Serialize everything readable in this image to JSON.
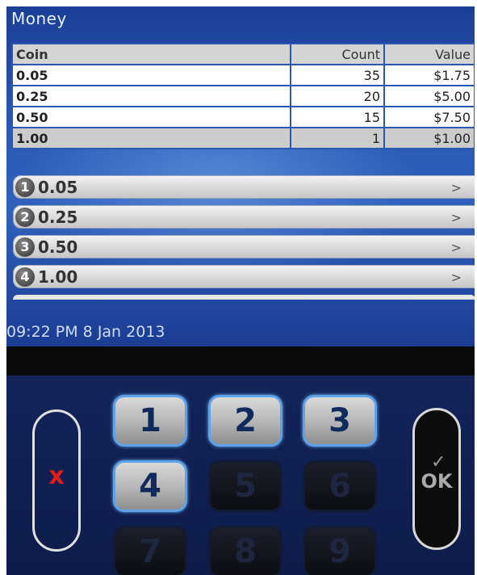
{
  "title": "Money",
  "table": {
    "headers": {
      "coin": "Coin",
      "count": "Count",
      "value": "Value"
    },
    "rows": [
      {
        "coin": "0.05",
        "count": "35",
        "value": "$1.75",
        "selected": false
      },
      {
        "coin": "0.25",
        "count": "20",
        "value": "$5.00",
        "selected": false
      },
      {
        "coin": "0.50",
        "count": "15",
        "value": "$7.50",
        "selected": false
      },
      {
        "coin": "1.00",
        "count": "1",
        "value": "$1.00",
        "selected": true
      }
    ]
  },
  "menu": [
    {
      "number": "1",
      "label": "0.05",
      "chevron": ">"
    },
    {
      "number": "2",
      "label": "0.25",
      "chevron": ">"
    },
    {
      "number": "3",
      "label": "0.50",
      "chevron": ">"
    },
    {
      "number": "4",
      "label": "1.00",
      "chevron": ">"
    }
  ],
  "datetime": "09:22 PM 8 Jan 2013",
  "keypad": {
    "cancel_icon": "x-icon",
    "cancel_symbol": "x",
    "ok_icon": "check-icon",
    "ok_check": "✓",
    "ok_label": "OK",
    "keys": [
      {
        "label": "1",
        "enabled": true
      },
      {
        "label": "2",
        "enabled": true
      },
      {
        "label": "3",
        "enabled": true
      },
      {
        "label": "4",
        "enabled": true
      },
      {
        "label": "5",
        "enabled": false
      },
      {
        "label": "6",
        "enabled": false
      },
      {
        "label": "7",
        "enabled": false
      },
      {
        "label": "8",
        "enabled": false
      },
      {
        "label": "9",
        "enabled": false
      }
    ]
  },
  "colors": {
    "display_blue": "#2a58b6",
    "key_border_active": "#5ea3ea",
    "cancel_red": "#e81919"
  }
}
